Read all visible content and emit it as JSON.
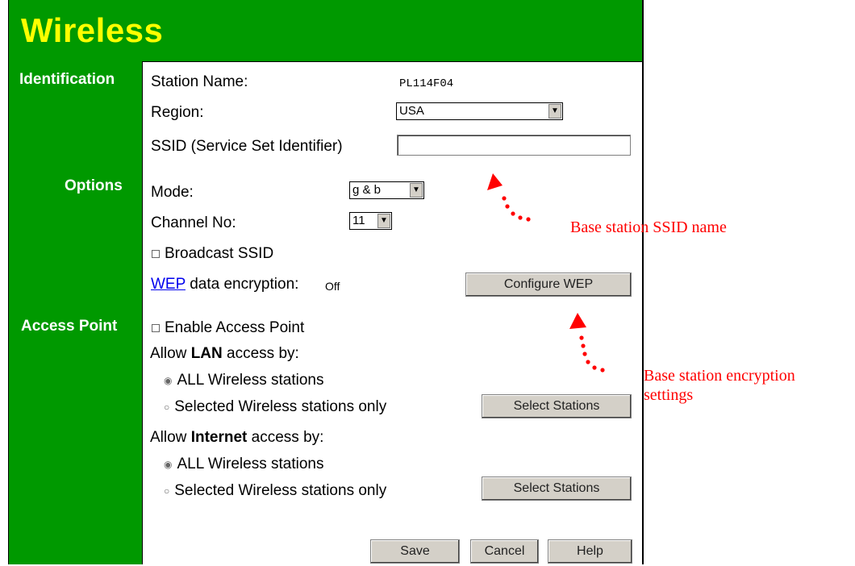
{
  "page": {
    "title": "Wireless"
  },
  "sections": {
    "identification": "Identification",
    "options": "Options",
    "access_point": "Access Point"
  },
  "identification": {
    "station_name_label": "Station Name:",
    "station_name_value": "PL114F04",
    "region_label": "Region:",
    "region_value": "USA",
    "ssid_label": "SSID (Service Set Identifier)",
    "ssid_value": ""
  },
  "options": {
    "mode_label": "Mode:",
    "mode_value": "g & b",
    "channel_label": "Channel No:",
    "channel_value": "11",
    "broadcast_ssid_label": "Broadcast SSID",
    "broadcast_ssid_checked": false,
    "wep_link": "WEP",
    "wep_label_rest": " data encryption:",
    "wep_status": "Off",
    "configure_wep_button": "Configure WEP"
  },
  "access_point": {
    "enable_label": "Enable Access Point",
    "enable_checked": false,
    "lan_prefix": "Allow ",
    "lan_bold": "LAN",
    "lan_suffix": " access by:",
    "lan_all": "ALL Wireless stations",
    "lan_selected": "Selected Wireless stations only",
    "lan_select_button": "Select Stations",
    "internet_prefix": "Allow ",
    "internet_bold": "Internet",
    "internet_suffix": " access by:",
    "internet_all": "ALL Wireless stations",
    "internet_selected": "Selected Wireless stations only",
    "internet_select_button": "Select Stations"
  },
  "footer": {
    "save": "Save",
    "cancel": "Cancel",
    "help": "Help"
  },
  "annotations": {
    "ssid_note": "Base station SSID name",
    "encryption_note_line1": "Base station encryption",
    "encryption_note_line2": "settings"
  },
  "colors": {
    "frame_green": "#009900",
    "title_yellow": "#ffff00",
    "annotation_red": "#ff0000"
  }
}
